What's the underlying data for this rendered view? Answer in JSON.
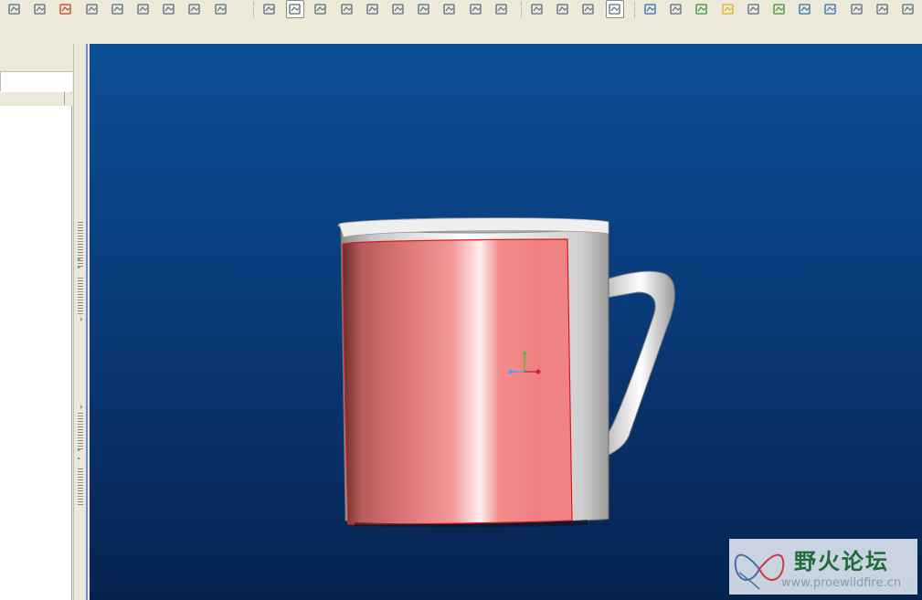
{
  "toolbar": {
    "groups": [
      [
        "undo-icon",
        "redo-icon",
        "cut-icon",
        "copy-icon",
        "paste-icon",
        "paste-special-icon",
        "regenerate-icon",
        "find-icon",
        "select-box-icon"
      ],
      [
        "repaint-icon",
        "spin-center-icon",
        "orient-icon",
        "zoom-in-icon",
        "zoom-out-icon",
        "refit-icon",
        "reorient-icon",
        "saved-views-icon",
        "layers-icon",
        "view-manager-icon"
      ],
      [
        "wireframe-icon",
        "hidden-line-icon",
        "no-hidden-icon",
        "shading-icon"
      ],
      [
        "appearance-icon",
        "model-display-icon",
        "datum-display-icon",
        "light-icon",
        "perspective-icon",
        "environment-icon",
        "render-icon",
        "render-settings-icon",
        "save-image-icon",
        "user-icon",
        "analysis-icon"
      ]
    ],
    "active": [
      "spin-center-icon",
      "shading-icon"
    ]
  },
  "colors": {
    "viewport_top": "#0b4f97",
    "viewport_bottom": "#06234f",
    "mug_white": "#f2f2f2",
    "highlight_surface": "#f08080",
    "edge_highlight": "#d81b1b",
    "csys_x": "#c8203a",
    "csys_y": "#3bc43b",
    "csys_z": "#4aa0ff"
  },
  "watermark": {
    "title": "野火论坛",
    "url": "www.proewildfire.cn"
  }
}
